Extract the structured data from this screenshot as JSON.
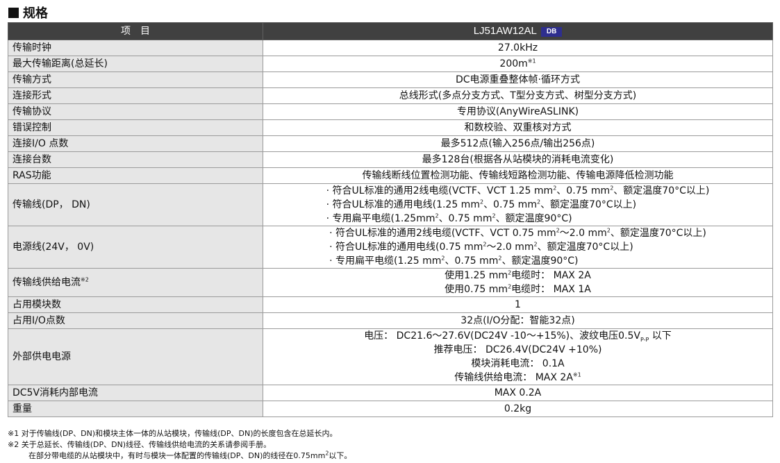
{
  "section": {
    "title": "规格"
  },
  "header": {
    "item": "项　目",
    "model": "LJ51AW12AL",
    "badge": "DB"
  },
  "rows": {
    "transfer_clock": {
      "label": "传输时钟",
      "value": "27.0kHz"
    },
    "max_distance": {
      "label": "最大传输距离(总延长)",
      "value": "200m",
      "mark": "※1"
    },
    "transfer_method": {
      "label": "传输方式",
      "value": "DC电源重叠整体帧·循环方式"
    },
    "connection_form": {
      "label": "连接形式",
      "value": "总线形式(多点分支方式、T型分支方式、树型分支方式)"
    },
    "protocol": {
      "label": "传输协议",
      "value": "专用协议(AnyWireASLINK)"
    },
    "error_control": {
      "label": "错误控制",
      "value": "和数校验、双重核对方式"
    },
    "io_points": {
      "label": "连接I/O 点数",
      "value": "最多512点(输入256点/输出256点)"
    },
    "units": {
      "label": "连接台数",
      "value": "最多128台(根据各从站模块的消耗电流变化)"
    },
    "ras": {
      "label": "RAS功能",
      "value": "传输线断线位置检测功能、传输线短路检测功能、传输电源降低检测功能"
    },
    "signal_line": {
      "label": "传输线(DP， DN)",
      "l1a": "· 符合UL标准的通用2线电缆(VCTF、VCT 1.25 mm",
      "l1b": "、0.75 mm",
      "l1c": "、额定温度70°C以上)",
      "l2a": "· 符合UL标准的通用电线(1.25 mm",
      "l2b": "、0.75 mm",
      "l2c": "、额定温度70°C以上)",
      "l3": "· 专用扁平电缆(1.25mm², 0.75 mm², 额定温度90°C)",
      "l3a": "· 专用扁平电缆(1.25mm",
      "l3b": "、0.75 mm",
      "l3c": "、额定温度90°C)"
    },
    "power_line": {
      "label": "电源线(24V， 0V)",
      "l1a": "· 符合UL标准的通用2线电缆(VCTF、VCT 0.75 mm",
      "l1b": "～2.0 mm",
      "l1c": "、额定温度70°C以上)",
      "l2a": "· 符合UL标准的通用电线(0.75 mm",
      "l2b": "～2.0 mm",
      "l2c": "、额定温度70°C以上)",
      "l3a": "· 专用扁平电缆(1.25 mm",
      "l3b": "、0.75 mm",
      "l3c": "、额定温度90°C)"
    },
    "supply_current": {
      "label": "传输线供给电流",
      "mark": "※2",
      "l1a": "使用1.25 mm",
      "l1b": "电缆时：  MAX 2A",
      "l2a": "使用0.75 mm",
      "l2b": "电缆时：  MAX 1A"
    },
    "occupied_modules": {
      "label": "占用模块数",
      "value": "1"
    },
    "occupied_io": {
      "label": "占用I/O点数",
      "value": "32点(I/O分配：智能32点)"
    },
    "external_power": {
      "label": "外部供电电源",
      "l1a": "电压：  DC21.6～27.6V(DC24V -10～+15%)、波纹电压0.5V",
      "l1sub": "P-P",
      "l1b": " 以下",
      "l2": "推荐电压：  DC26.4V(DC24V +10%)",
      "l3": "模块消耗电流：  0.1A",
      "l4": "传输线供给电流：  MAX 2A",
      "l4mark": "※1"
    },
    "dc5v": {
      "label": "DC5V消耗内部电流",
      "value": "MAX 0.2A"
    },
    "weight": {
      "label": "重量",
      "value": "0.2kg"
    }
  },
  "sup2": "2",
  "notes": {
    "n1": "※1  对于传输线(DP、DN)和模块主体一体的从站模块，传输线(DP、DN)的长度包含在总延长内。",
    "n2": "※2  关于总延长、传输线(DP、DN)线径、传输线供给电流的关系请参阅手册。",
    "n3a": "在部分带电缆的从站模块中，有时与模块一体配置的传输线(DP、DN)的线径在0.75mm",
    "n3b": "以下。"
  }
}
